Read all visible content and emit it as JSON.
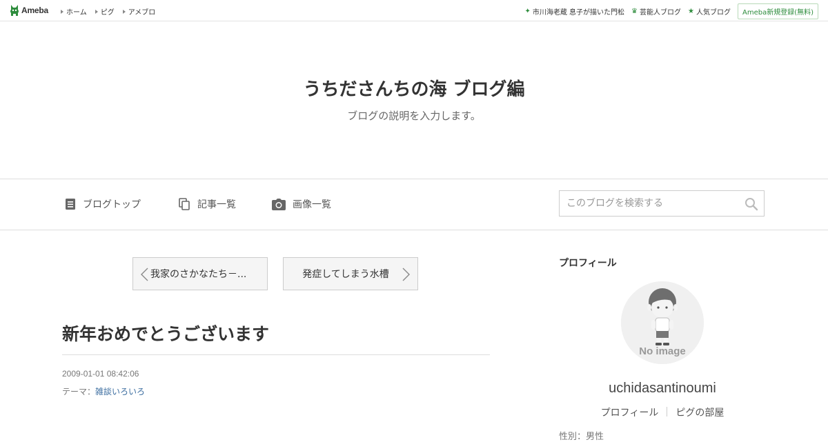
{
  "topbar": {
    "logo_text": "Ameba",
    "nav": [
      "ホーム",
      "ピグ",
      "アメブロ"
    ],
    "featured_link": "市川海老蔵 息子が描いた門松",
    "celeb_link": "芸能人ブログ",
    "popular_link": "人気ブログ",
    "signup_label": "Ameba新規登録(無料)"
  },
  "header": {
    "title": "うちださんちの海 ブログ編",
    "description": "ブログの説明を入力します。"
  },
  "navbar": {
    "blog_top": "ブログトップ",
    "articles": "記事一覧",
    "images": "画像一覧",
    "search_placeholder": "このブログを検索する"
  },
  "pager": {
    "prev": "我家のさかなたち－...",
    "next": "発症してしまう水槽"
  },
  "entry": {
    "title": "新年おめでとうございます",
    "date": "2009-01-01 08:42:06",
    "theme_label": "テーマ：",
    "theme": "雑談いろいろ"
  },
  "sidebar": {
    "heading": "プロフィール",
    "avatar_text": "No image",
    "username": "uchidasantinoumi",
    "profile_link": "プロフィール",
    "room_link": "ピグの部屋",
    "cutoff_text": "性別：男性"
  },
  "colors": {
    "accent_green": "#2d8c3c",
    "link_blue": "#3c6ea0"
  }
}
